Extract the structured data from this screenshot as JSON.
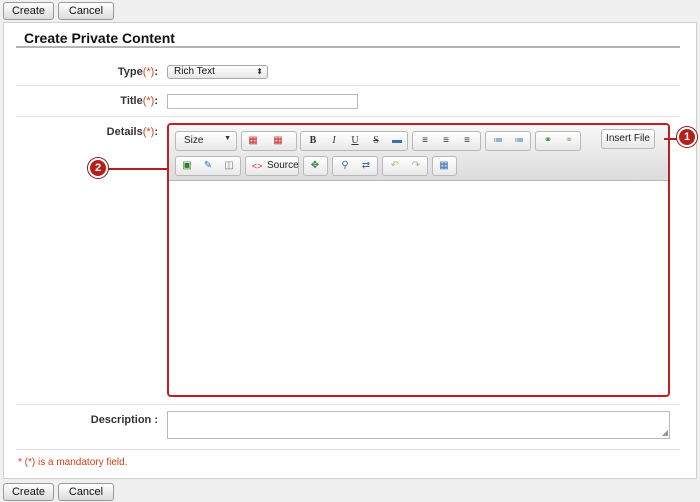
{
  "toolbar_top": {
    "create_label": "Create",
    "cancel_label": "Cancel"
  },
  "toolbar_bottom": {
    "create_label": "Create",
    "cancel_label": "Cancel"
  },
  "form": {
    "title": "Create Private Content",
    "type": {
      "label": "Type",
      "required_mark": "(*)",
      "colon": ":",
      "selected": "Rich Text"
    },
    "title_field": {
      "label": "Title",
      "required_mark": "(*)",
      "colon": ":",
      "value": ""
    },
    "details": {
      "label": "Details",
      "required_mark": "(*)",
      "colon": ":"
    },
    "description": {
      "label": "Description",
      "colon": ":",
      "value": ""
    },
    "mandatory_note": "* (*) is a mandatory field."
  },
  "editor": {
    "size_label": "Size",
    "source_label": "Source",
    "insert_file_label": "Insert File",
    "row1_buttons": [
      "text-color",
      "table",
      "bold",
      "italic",
      "underline",
      "strike",
      "hr",
      "align-left",
      "align-center",
      "align-right",
      "ordered-list",
      "bullet-list",
      "link",
      "unlink"
    ],
    "row2_buttons": [
      "image",
      "paste-word",
      "preview",
      "source",
      "maximize",
      "find",
      "replace",
      "undo",
      "redo",
      "show-blocks"
    ]
  },
  "callouts": {
    "one": "1",
    "two": "2"
  },
  "colors": {
    "required": "#d3411b",
    "callout": "#b5201c"
  }
}
